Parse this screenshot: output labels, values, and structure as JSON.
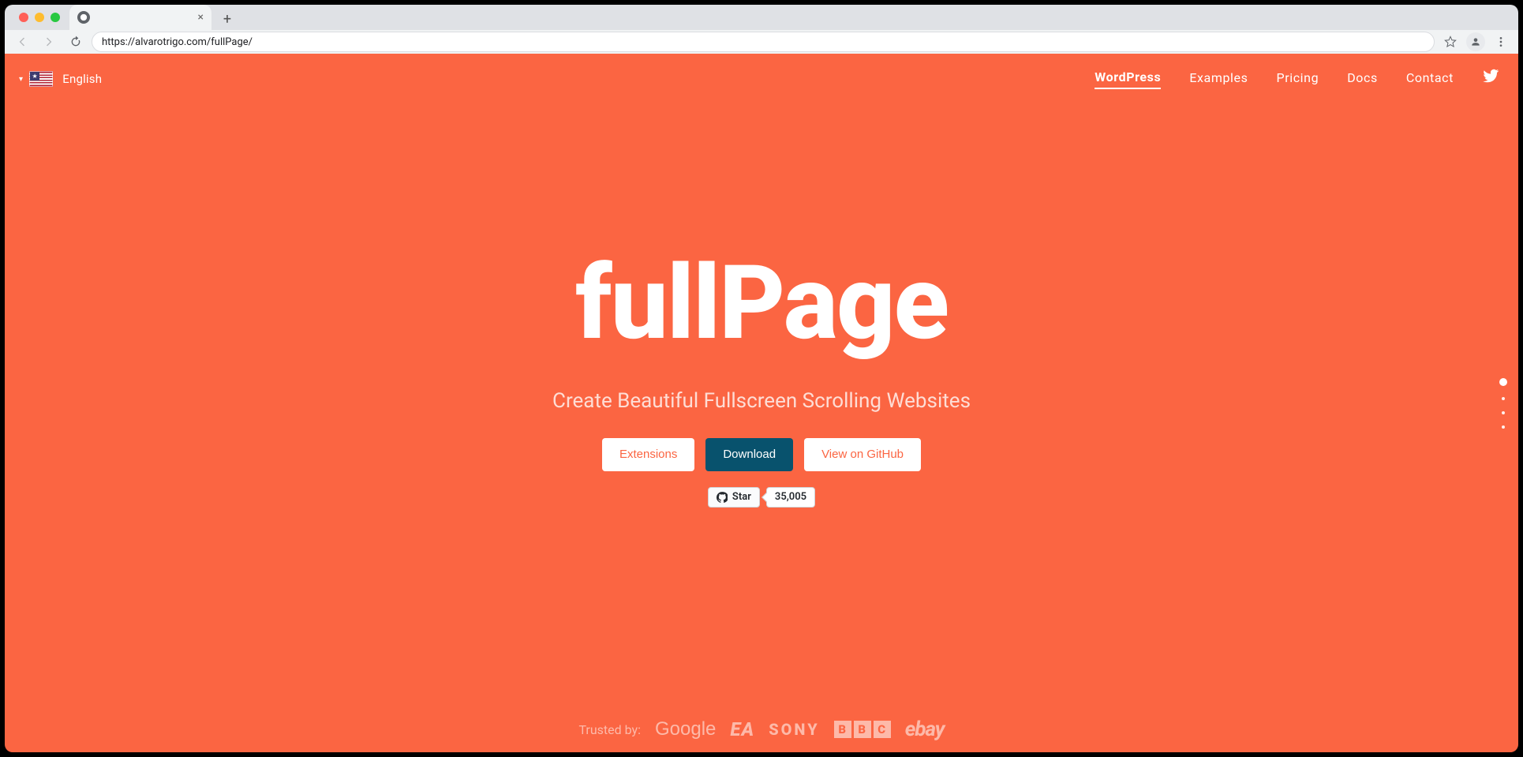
{
  "browser": {
    "url": "https://alvarotrigo.com/fullPage/",
    "tab_title": ""
  },
  "lang": {
    "label": "English"
  },
  "nav": {
    "items": [
      {
        "label": "WordPress",
        "active": true
      },
      {
        "label": "Examples",
        "active": false
      },
      {
        "label": "Pricing",
        "active": false
      },
      {
        "label": "Docs",
        "active": false
      },
      {
        "label": "Contact",
        "active": false
      }
    ]
  },
  "hero": {
    "title": "fullPage",
    "subtitle": "Create Beautiful Fullscreen Scrolling Websites",
    "buttons": {
      "extensions": "Extensions",
      "download": "Download",
      "github": "View on GitHub"
    },
    "gh": {
      "star_label": "Star",
      "star_count": "35,005"
    }
  },
  "trusted": {
    "label": "Trusted by:",
    "brands": {
      "google": "Google",
      "ea": "EA",
      "sony": "SONY",
      "bbc": [
        "B",
        "B",
        "C"
      ],
      "ebay": "ebay"
    }
  },
  "section_nav": {
    "count": 4,
    "active_index": 0
  }
}
